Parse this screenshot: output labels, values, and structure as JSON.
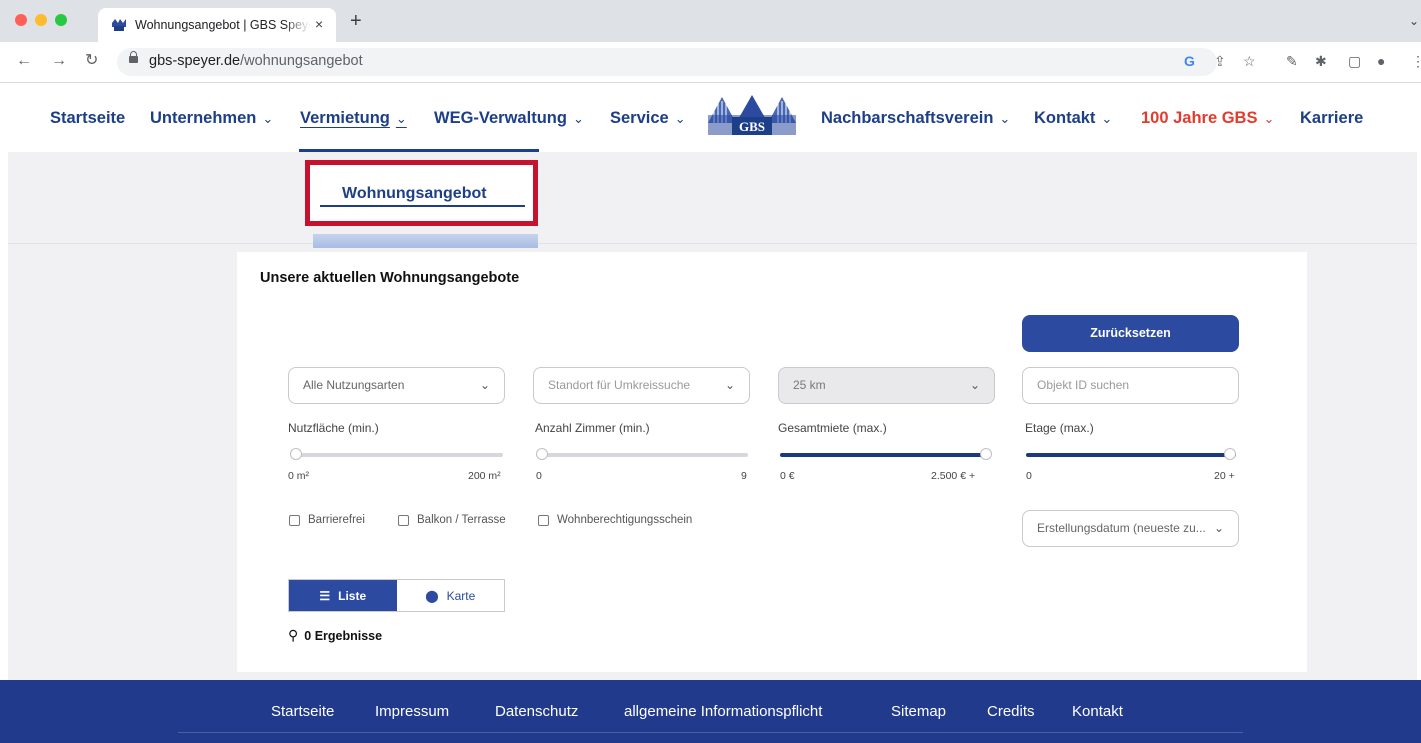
{
  "browser": {
    "tab_title": "Wohnungsangebot | GBS Speyer",
    "tab_close": "×",
    "new_tab": "+",
    "url_host": "gbs-speyer.de",
    "url_path": "/wohnungsangebot",
    "icons": [
      "back-icon",
      "forward-icon",
      "reload-icon",
      "lock-icon",
      "google-icon",
      "share-icon",
      "star-icon",
      "extension-icon",
      "puzzle-icon",
      "sidebar-icon",
      "profile-icon",
      "menu-icon"
    ]
  },
  "nav": {
    "items": [
      {
        "label": "Startseite",
        "has_menu": false
      },
      {
        "label": "Unternehmen",
        "has_menu": true
      },
      {
        "label": "Vermietung",
        "has_menu": true
      },
      {
        "label": "WEG-Verwaltung",
        "has_menu": true
      },
      {
        "label": "Service",
        "has_menu": true
      },
      {
        "label": "Nachbarschaftsverein",
        "has_menu": true
      },
      {
        "label": "Kontakt",
        "has_menu": true
      },
      {
        "label": "100 Jahre GBS",
        "has_menu": true
      },
      {
        "label": "Karriere",
        "has_menu": false
      }
    ],
    "chevron": "⌄",
    "logo_text": "GBS",
    "submenu_item": "Wohnungsangebot",
    "accent": "#1d3f87",
    "highlight": "#c4122f",
    "red_item": "#e33b2e"
  },
  "main": {
    "heading": "Unsere aktuellen Wohnungsangebote",
    "reset_label": "Zurücksetzen",
    "selects": {
      "nutzungsarten": "Alle Nutzungsarten",
      "standort_placeholder": "Standort für Umkreissuche",
      "radius": "25 km",
      "objekt_id_placeholder": "Objekt ID suchen",
      "sort": "Erstellungsdatum (neueste zu..."
    },
    "sliders": {
      "nutzflaeche": {
        "label": "Nutzfläche (min.)",
        "min": "0 m²",
        "max": "200 m²",
        "value": 0
      },
      "zimmer": {
        "label": "Anzahl Zimmer (min.)",
        "min": "0",
        "max": "9",
        "value": 0
      },
      "miete": {
        "label": "Gesamtmiete (max.)",
        "min": "0 €",
        "max": "2.500 € +",
        "value": 1.0
      },
      "etage": {
        "label": "Etage (max.)",
        "min": "0",
        "max": "20 +",
        "value": 1.0
      }
    },
    "checkboxes": [
      "Barrierefrei",
      "Balkon / Terrasse",
      "Wohnberechtigungsschein"
    ],
    "view_toggle": {
      "list": "Liste",
      "map": "Karte"
    },
    "results": "0 Ergebnisse"
  },
  "footer": {
    "links": [
      "Startseite",
      "Impressum",
      "Datenschutz",
      "allgemeine Informationspflicht",
      "Sitemap",
      "Credits",
      "Kontakt"
    ]
  }
}
